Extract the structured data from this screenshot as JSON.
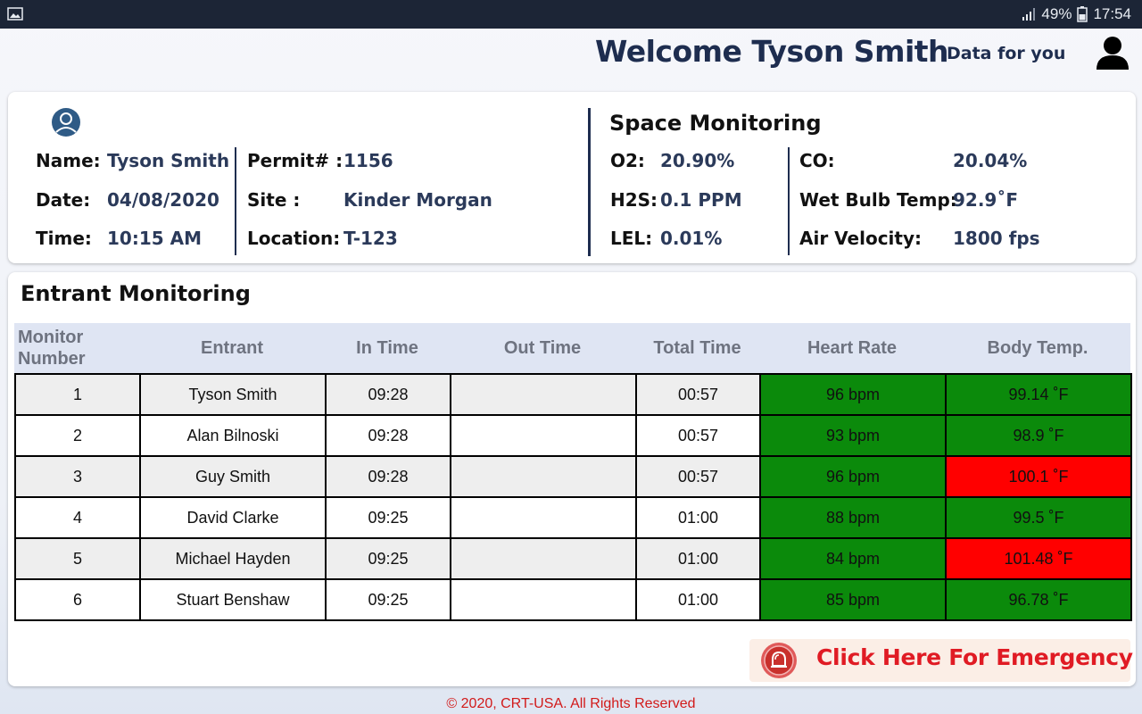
{
  "status_bar": {
    "battery": "49%",
    "time": "17:54",
    "icons": [
      "image-icon",
      "signal-icon",
      "battery-icon"
    ]
  },
  "header": {
    "welcome": "Welcome Tyson Smith",
    "subtitle": "Data for you",
    "user_icon": "user-icon"
  },
  "permit": {
    "name_label": "Name:",
    "name": "Tyson Smith",
    "date_label": "Date:",
    "date": "04/08/2020",
    "time_label": "Time:",
    "time": "10:15 AM",
    "permit_label": "Permit# :",
    "permit": "1156",
    "site_label": "Site :",
    "site": "Kinder Morgan",
    "location_label": "Location:",
    "location": "T-123"
  },
  "space": {
    "title": "Space Monitoring",
    "o2_label": "O2:",
    "o2": "20.90%",
    "h2s_label": "H2S:",
    "h2s": "0.1 PPM",
    "lel_label": "LEL:",
    "lel": "0.01%",
    "co_label": "CO:",
    "co": "20.04%",
    "wbt_label": "Wet Bulb Temp:",
    "wbt": "92.9˚F",
    "air_label": "Air Velocity:",
    "air": "1800 fps"
  },
  "entrant": {
    "title": "Entrant Monitoring",
    "columns": [
      "Monitor Number",
      "Entrant",
      "In Time",
      "Out Time",
      "Total Time",
      "Heart Rate",
      "Body Temp."
    ],
    "rows": [
      {
        "num": "1",
        "name": "Tyson Smith",
        "in": "09:28",
        "out": "",
        "total": "00:57",
        "hr": "96 bpm",
        "temp": "99.14 ˚F",
        "temp_status": "ok"
      },
      {
        "num": "2",
        "name": "Alan Bilnoski",
        "in": "09:28",
        "out": "",
        "total": "00:57",
        "hr": "93 bpm",
        "temp": "98.9 ˚F",
        "temp_status": "ok"
      },
      {
        "num": "3",
        "name": "Guy Smith",
        "in": "09:28",
        "out": "",
        "total": "00:57",
        "hr": "96 bpm",
        "temp": "100.1 ˚F",
        "temp_status": "alert"
      },
      {
        "num": "4",
        "name": "David Clarke",
        "in": "09:25",
        "out": "",
        "total": "01:00",
        "hr": "88 bpm",
        "temp": "99.5 ˚F",
        "temp_status": "ok"
      },
      {
        "num": "5",
        "name": "Michael Hayden",
        "in": "09:25",
        "out": "",
        "total": "01:00",
        "hr": "84 bpm",
        "temp": "101.48 ˚F",
        "temp_status": "alert"
      },
      {
        "num": "6",
        "name": "Stuart Benshaw",
        "in": "09:25",
        "out": "",
        "total": "01:00",
        "hr": "85 bpm",
        "temp": "96.78 ˚F",
        "temp_status": "ok"
      }
    ]
  },
  "emergency": {
    "label": "Click Here For Emergency",
    "icon": "alarm-bell-icon"
  },
  "footer": {
    "copyright": "© 2020, CRT-USA. All Rights Reserved"
  },
  "colors": {
    "ok": "#0b8a0b",
    "alert": "#ff0000",
    "navy": "#1e2d4f",
    "emergency_text": "#e01b24"
  }
}
